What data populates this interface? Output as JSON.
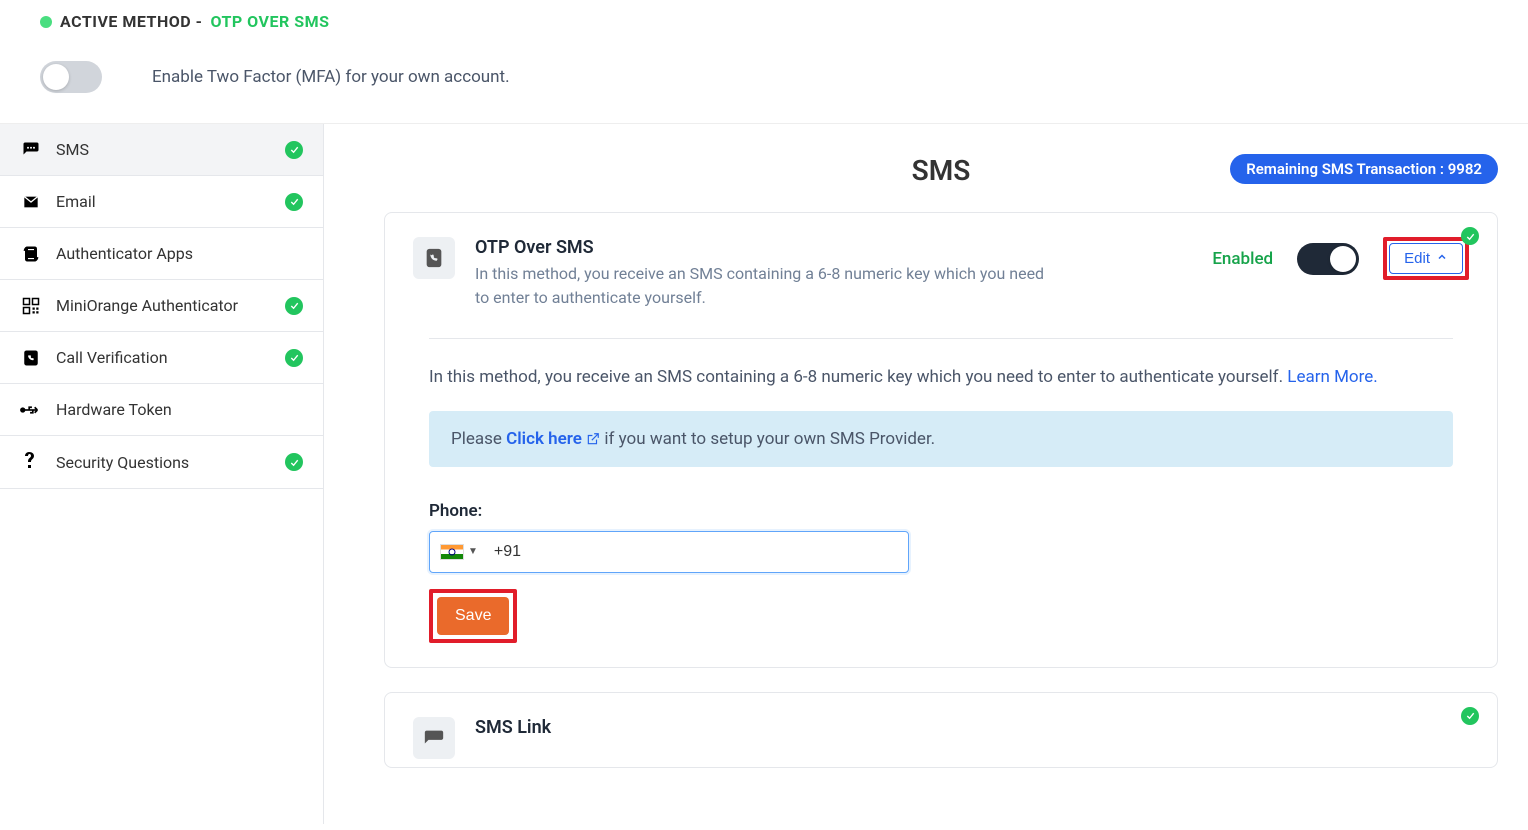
{
  "header": {
    "active_method_label": "ACTIVE METHOD - ",
    "active_method_name": "OTP OVER SMS",
    "enable_mfa_text": "Enable Two Factor (MFA) for your own account."
  },
  "sidebar": {
    "items": [
      {
        "label": "SMS",
        "checked": true,
        "active": true
      },
      {
        "label": "Email",
        "checked": true,
        "active": false
      },
      {
        "label": "Authenticator Apps",
        "checked": false,
        "active": false
      },
      {
        "label": "MiniOrange Authenticator",
        "checked": true,
        "active": false
      },
      {
        "label": "Call Verification",
        "checked": true,
        "active": false
      },
      {
        "label": "Hardware Token",
        "checked": false,
        "active": false
      },
      {
        "label": "Security Questions",
        "checked": true,
        "active": false
      }
    ]
  },
  "main": {
    "title": "SMS",
    "remaining_label": "Remaining SMS Transaction : 9982"
  },
  "otp_card": {
    "title": "OTP Over SMS",
    "subtitle": "In this method, you receive an SMS containing a 6-8 numeric key which you need to enter to authenticate yourself.",
    "enabled_text": "Enabled",
    "edit_label": "Edit",
    "body_text": "In this method, you receive an SMS containing a 6-8 numeric key which you need to enter to authenticate yourself. ",
    "learn_more": "Learn More.",
    "info_prefix": "Please ",
    "info_link": "Click here",
    "info_suffix": " if you want to setup your own SMS Provider.",
    "phone_label": "Phone:",
    "phone_value": "+91",
    "save_label": "Save"
  },
  "sms_link_card": {
    "title": "SMS Link"
  }
}
